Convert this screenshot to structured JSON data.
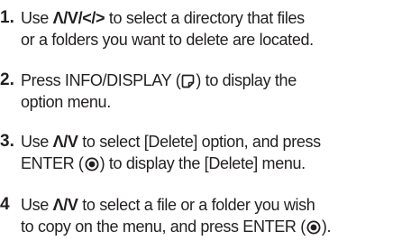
{
  "steps": [
    {
      "number": "1.",
      "line1": {
        "before": "Use ",
        "arrows": "Λ/V/</>",
        "after": " to select a directory that files"
      },
      "line2": "or a folders you want to delete are located."
    },
    {
      "number": "2.",
      "line1": {
        "before": "Press INFO/DISPLAY (",
        "icon": "info-display-icon",
        "after": ") to display the"
      },
      "line2": "option menu."
    },
    {
      "number": "3.",
      "line1": {
        "before": "Use ",
        "arrows": "Λ/V",
        "after": " to select [Delete] option, and press"
      },
      "line2": {
        "before": "ENTER (",
        "icon": "enter-icon",
        "after": ") to display the [Delete] menu."
      }
    },
    {
      "number": "4",
      "line1": {
        "before": "Use ",
        "arrows": "Λ/V",
        "after": " to select a file or a folder you wish"
      },
      "line2": {
        "before": "to copy on the menu, and press ENTER (",
        "icon": "enter-icon",
        "after": ")."
      }
    }
  ]
}
